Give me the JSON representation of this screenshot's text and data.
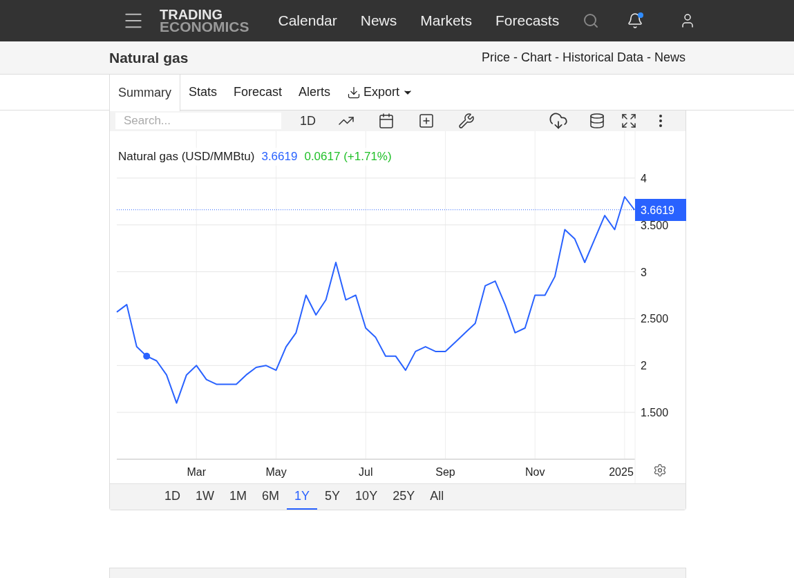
{
  "nav": {
    "logo_top": "TRADING",
    "logo_bottom": "ECONOMICS",
    "items": [
      "Calendar",
      "News",
      "Markets",
      "Forecasts"
    ],
    "has_notification": true
  },
  "page": {
    "title": "Natural gas",
    "links": [
      "Price",
      "Chart",
      "Historical Data",
      "News"
    ],
    "separator": "-"
  },
  "tabs": [
    {
      "label": "Summary",
      "selected": true
    },
    {
      "label": "Stats",
      "selected": false
    },
    {
      "label": "Forecast",
      "selected": false
    },
    {
      "label": "Alerts",
      "selected": false
    },
    {
      "label": "Export",
      "selected": false
    }
  ],
  "toolbar": {
    "search": {
      "placeholder": "Search..."
    },
    "interval": "1D"
  },
  "legend": {
    "name": "Natural gas (USD/MMBtu)",
    "price": "3.6619",
    "change": "0.0617 (+1.71%)"
  },
  "price_tag": "3.6619",
  "chart_data": {
    "type": "line",
    "categories": [
      null,
      null,
      null,
      null,
      null,
      null,
      null,
      null,
      "Mar",
      null,
      null,
      null,
      null,
      null,
      null,
      null,
      "May",
      null,
      null,
      null,
      null,
      null,
      null,
      null,
      null,
      "Jul",
      null,
      null,
      null,
      null,
      null,
      null,
      null,
      "Sep",
      null,
      null,
      null,
      null,
      null,
      null,
      null,
      null,
      "Nov",
      null,
      null,
      null,
      null,
      null,
      null,
      null,
      null,
      "2025",
      null
    ],
    "series": [
      {
        "color": "#2962ff",
        "values": [
          2.57,
          2.65,
          2.2,
          2.1,
          2.05,
          1.9,
          1.6,
          1.9,
          2.0,
          1.85,
          1.8,
          1.8,
          1.8,
          1.9,
          1.98,
          2.0,
          1.95,
          2.2,
          2.35,
          2.75,
          2.54,
          2.7,
          3.1,
          2.7,
          2.75,
          2.4,
          2.3,
          2.1,
          2.1,
          1.95,
          2.15,
          2.2,
          2.15,
          2.15,
          2.25,
          2.35,
          2.45,
          2.85,
          2.9,
          2.65,
          2.35,
          2.4,
          2.75,
          2.75,
          2.95,
          3.45,
          3.35,
          3.1,
          3.35,
          3.6,
          3.45,
          3.8,
          3.66
        ]
      }
    ],
    "ylim": [
      1.0,
      4.5
    ],
    "grid": true,
    "ref_lines": [
      {
        "axis": "y",
        "value": 3.6619,
        "color": "#2962ff"
      }
    ],
    "yticks": [
      {
        "value": 1.5,
        "label": "1.500"
      },
      {
        "value": 2,
        "label": "2"
      },
      {
        "value": 2.5,
        "label": "2.500"
      },
      {
        "value": 3,
        "label": "3"
      },
      {
        "value": 3.5,
        "label": "3.500"
      },
      {
        "value": 4,
        "label": "4"
      }
    ]
  },
  "ranges": [
    {
      "label": "1D",
      "selected": false
    },
    {
      "label": "1W",
      "selected": false
    },
    {
      "label": "1M",
      "selected": false
    },
    {
      "label": "6M",
      "selected": false
    },
    {
      "label": "1Y",
      "selected": true
    },
    {
      "label": "5Y",
      "selected": false
    },
    {
      "label": "10Y",
      "selected": false
    },
    {
      "label": "25Y",
      "selected": false
    },
    {
      "label": "All",
      "selected": false
    }
  ]
}
